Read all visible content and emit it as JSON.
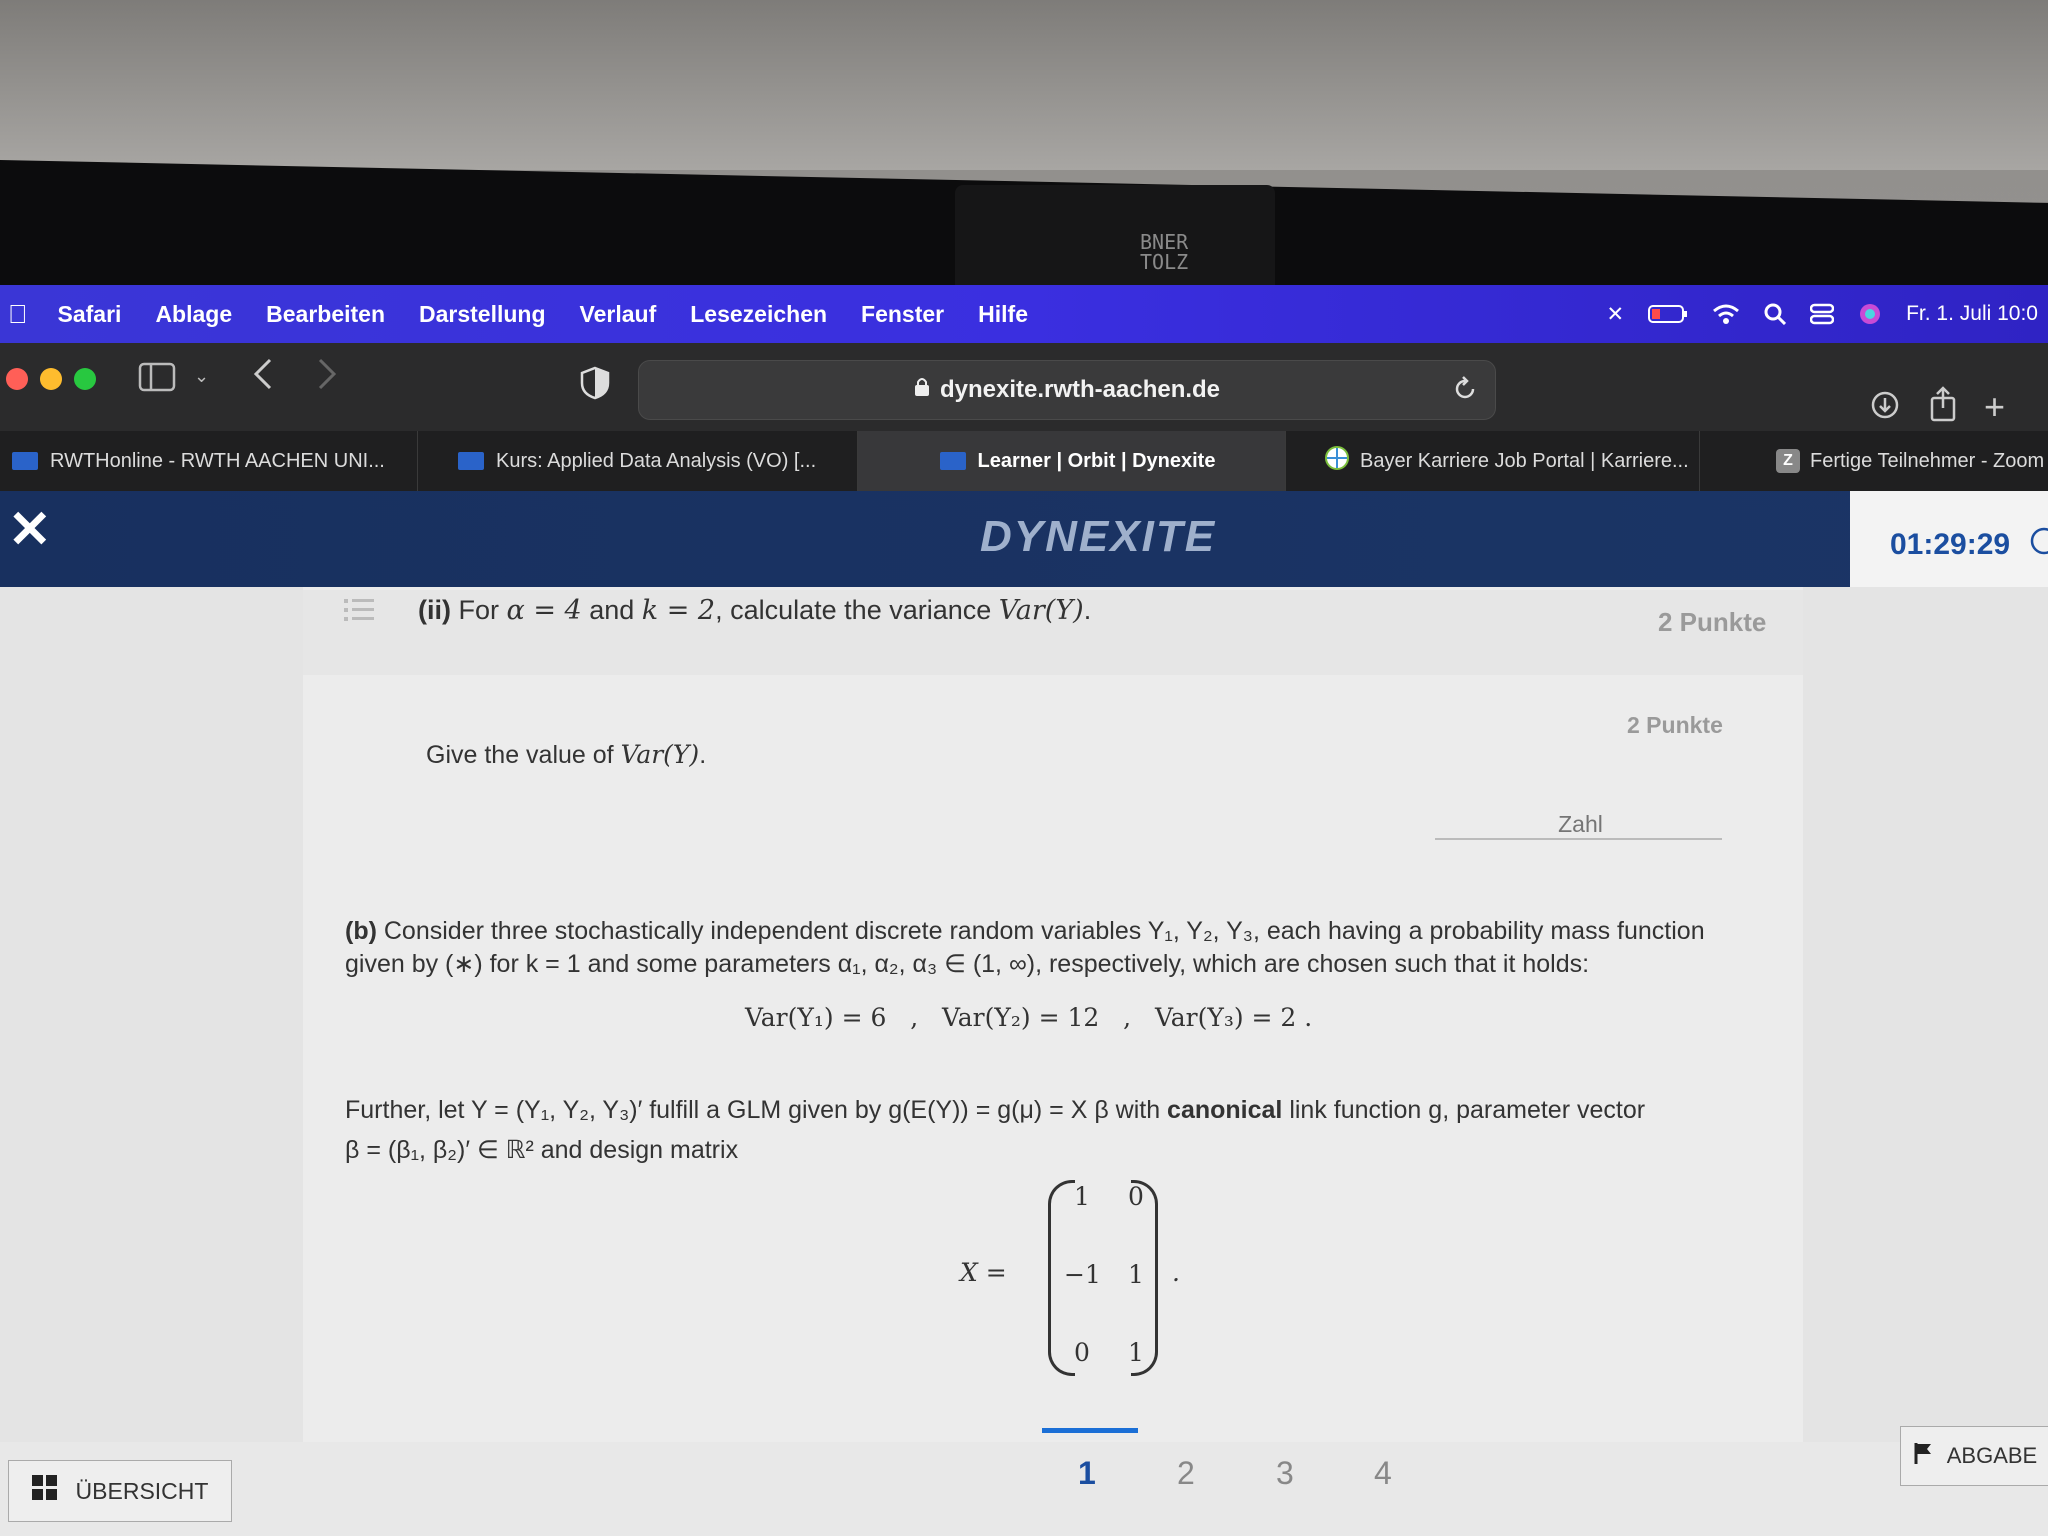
{
  "menubar": {
    "app": "Safari",
    "items": [
      "Ablage",
      "Bearbeiten",
      "Darstellung",
      "Verlauf",
      "Lesezeichen",
      "Fenster",
      "Hilfe"
    ],
    "clock": "Fr. 1. Juli  10:0"
  },
  "sticker": {
    "line1": "BNER",
    "line2": "TOLZ"
  },
  "browser": {
    "url": "dynexite.rwth-aachen.de",
    "tabs": [
      {
        "label": "RWTHonline - RWTH AACHEN UNI..."
      },
      {
        "label": "Kurs: Applied Data Analysis (VO) [..."
      },
      {
        "label": "Learner | Orbit | Dynexite"
      },
      {
        "label": "Bayer Karriere Job Portal | Karriere..."
      },
      {
        "label": "Fertige Teilnehmer - Zoom"
      }
    ]
  },
  "app": {
    "logo": "DYNEXITE",
    "timer": "01:29:29"
  },
  "question": {
    "ii_prefix": "(ii)",
    "ii_text_1": " For ",
    "ii_math_1": "α = 4",
    "ii_text_2": " and ",
    "ii_math_2": "k = 2",
    "ii_text_3": ", calculate the variance ",
    "ii_math_3": "Var(Y)",
    "ii_text_4": ".",
    "ii_points": "2 Punkte",
    "sub_points": "2 Punkte",
    "give_text": "Give the value of ",
    "give_math": "Var(Y)",
    "give_end": ".",
    "input_placeholder": "Zahl",
    "b_prefix": "(b)",
    "b_line1": " Consider three stochastically independent discrete random variables Y₁, Y₂, Y₃, each having a probability mass function",
    "b_line2": "given by (∗) for k = 1 and some parameters α₁, α₂, α₃ ∈ (1, ∞), respectively, which are chosen such that it holds:",
    "var_eq": "Var(Y₁) = 6   ,   Var(Y₂) = 12   ,   Var(Y₃) = 2 .",
    "further_1": "Further, let Y = (Y₁, Y₂, Y₃)′ fulfill a GLM given by g(E(Y)) = g(μ) = X β with ",
    "canonical": "canonical",
    "further_2": " link function g, parameter vector",
    "further_3": "β = (β₁, β₂)′ ∈ ℝ² and design matrix",
    "matrix_label": "X =",
    "matrix": [
      [
        "1",
        "0"
      ],
      [
        "−1",
        "1"
      ],
      [
        "0",
        "1"
      ]
    ],
    "matrix_end": "."
  },
  "footer": {
    "overview": "ÜBERSICHT",
    "pages": [
      "1",
      "2",
      "3",
      "4"
    ],
    "active_page": "1",
    "submit": "ABGABE"
  }
}
